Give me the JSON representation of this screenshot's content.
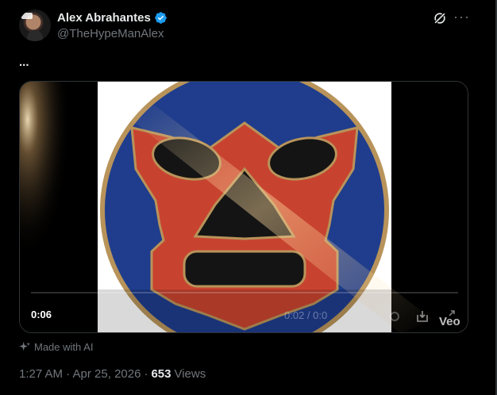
{
  "author": {
    "display_name": "Alex Abrahantes",
    "handle": "@TheHypeManAlex",
    "verified": true,
    "accent": "#1d9bf0"
  },
  "header_icons": [
    "grok-icon",
    "more-icon"
  ],
  "tweet": {
    "text": "...",
    "posted_time": "1:27 AM · Apr 25, 2026",
    "separator": "·",
    "views_count": "653",
    "views_label": "Views",
    "ai_label": "Made with AI"
  },
  "video": {
    "elapsed": "0:06",
    "time_display": "0:02 / 0:0",
    "watermark": "Veo",
    "colors": {
      "mask_red": "#c8432f",
      "circle_blue": "#1f3d8c",
      "gold_rim": "#b8935a"
    }
  }
}
